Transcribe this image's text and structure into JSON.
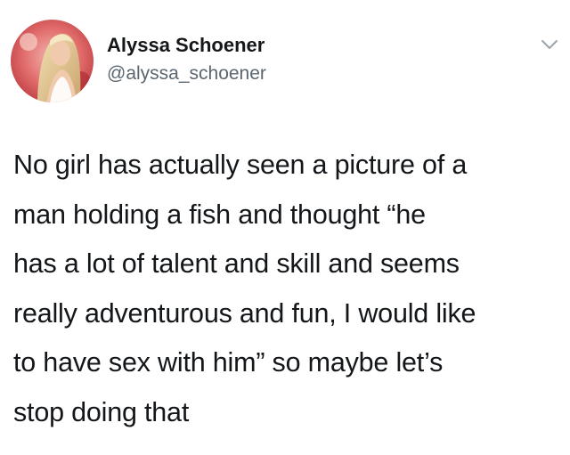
{
  "author": {
    "display_name": "Alyssa Schoener",
    "handle": "@alyssa_schoener",
    "avatar_icon": "profile-photo"
  },
  "tweet": {
    "text": "No girl has actually seen a picture of a\nman holding a fish and thought “he\nhas a lot of talent and skill and seems\nreally adventurous and fun, I would like\nto have sex with him” so maybe let’s\nstop doing that"
  },
  "menu": {
    "icon": "chevron-down-icon"
  },
  "colors": {
    "text": "#14171a",
    "secondary_text": "#5b6670",
    "icon": "#9aa5ae",
    "background": "#ffffff"
  }
}
